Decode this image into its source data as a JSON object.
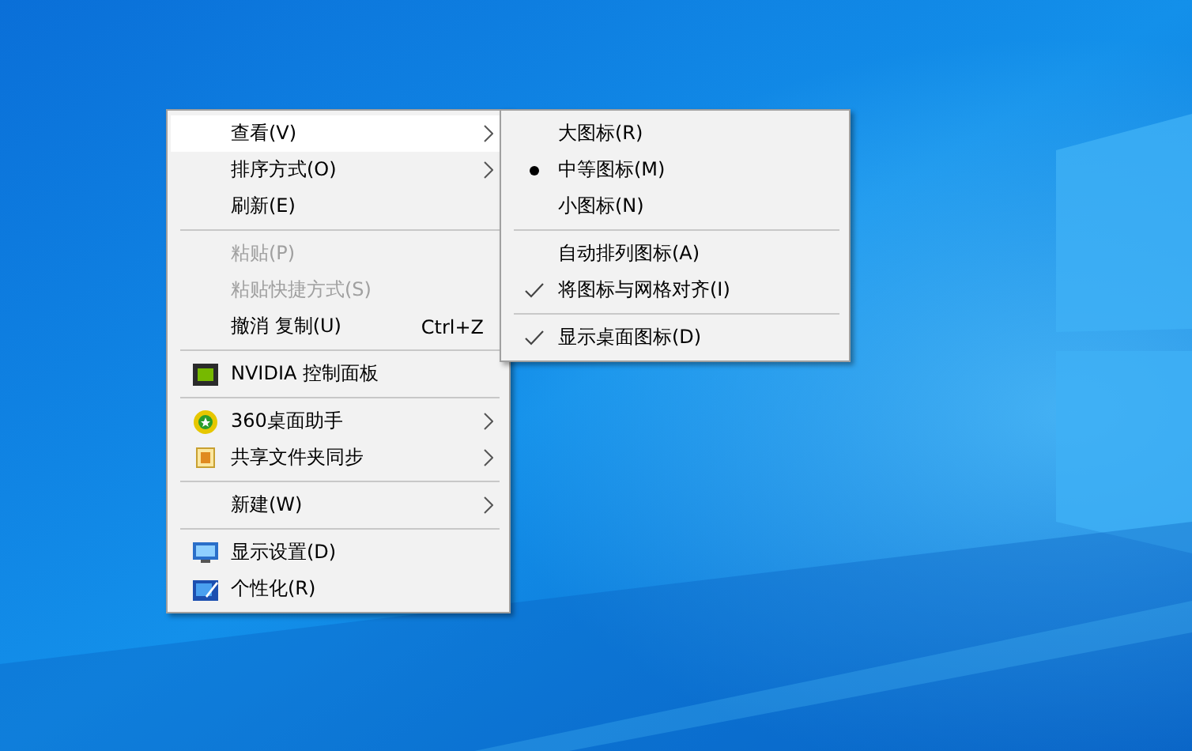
{
  "context_menu": {
    "items": [
      {
        "kind": "item",
        "label": "查看(V)",
        "has_submenu": true,
        "selected": true,
        "disabled": false
      },
      {
        "kind": "item",
        "label": "排序方式(O)",
        "has_submenu": true,
        "selected": false,
        "disabled": false
      },
      {
        "kind": "item",
        "label": "刷新(E)",
        "has_submenu": false,
        "selected": false,
        "disabled": false
      },
      {
        "kind": "separator"
      },
      {
        "kind": "item",
        "label": "粘贴(P)",
        "has_submenu": false,
        "selected": false,
        "disabled": true
      },
      {
        "kind": "item",
        "label": "粘贴快捷方式(S)",
        "has_submenu": false,
        "selected": false,
        "disabled": true
      },
      {
        "kind": "item",
        "label": "撤消 复制(U)",
        "shortcut": "Ctrl+Z",
        "has_submenu": false,
        "selected": false,
        "disabled": false
      },
      {
        "kind": "separator"
      },
      {
        "kind": "item",
        "label": "NVIDIA 控制面板",
        "icon": true,
        "has_submenu": false,
        "selected": false,
        "disabled": false
      },
      {
        "kind": "separator"
      },
      {
        "kind": "item",
        "label": "360桌面助手",
        "icon": true,
        "has_submenu": true,
        "selected": false,
        "disabled": false
      },
      {
        "kind": "item",
        "label": "共享文件夹同步",
        "icon": true,
        "has_submenu": true,
        "selected": false,
        "disabled": false
      },
      {
        "kind": "separator"
      },
      {
        "kind": "item",
        "label": "新建(W)",
        "has_submenu": true,
        "selected": false,
        "disabled": false
      },
      {
        "kind": "separator"
      },
      {
        "kind": "item",
        "label": "显示设置(D)",
        "icon": true,
        "has_submenu": false,
        "selected": false,
        "disabled": false
      },
      {
        "kind": "item",
        "label": "个性化(R)",
        "icon": true,
        "has_submenu": false,
        "selected": false,
        "disabled": false
      }
    ]
  },
  "view_submenu": {
    "items": [
      {
        "kind": "radio",
        "label": "大图标(R)",
        "selected": false
      },
      {
        "kind": "radio",
        "label": "中等图标(M)",
        "selected": true
      },
      {
        "kind": "radio",
        "label": "小图标(N)",
        "selected": false
      },
      {
        "kind": "separator"
      },
      {
        "kind": "check",
        "label": "自动排列图标(A)",
        "checked": false
      },
      {
        "kind": "check",
        "label": "将图标与网格对齐(I)",
        "checked": true
      },
      {
        "kind": "separator"
      },
      {
        "kind": "check",
        "label": "显示桌面图标(D)",
        "checked": true
      }
    ]
  }
}
